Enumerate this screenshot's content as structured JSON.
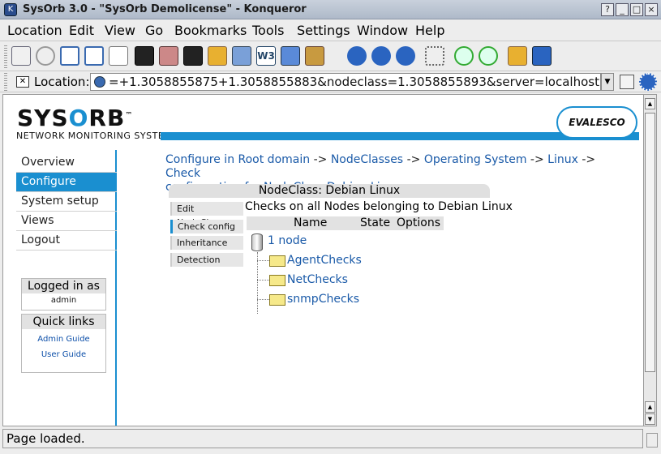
{
  "window": {
    "title": "SysOrb 3.0 - \"SysOrb Demolicense\" - Konqueror"
  },
  "menu": [
    "Location",
    "Edit",
    "View",
    "Go",
    "Bookmarks",
    "Tools",
    "Settings",
    "Window",
    "Help"
  ],
  "location": {
    "label": "Location:",
    "url": "=+1.3058855875+1.3058855883&nodeclass=1.3058855893&server=localhost:2211"
  },
  "site": {
    "logo_pre": "SYS",
    "logo_o": "O",
    "logo_post": "RB",
    "tm": "™",
    "tagline": "NETWORK MONITORING SYSTEM",
    "partner_logo": "EVALESCO"
  },
  "nav": [
    "Overview",
    "Configure",
    "System setup",
    "Views",
    "Logout"
  ],
  "logged_in": {
    "title": "Logged in as",
    "user": "admin"
  },
  "quick_links": {
    "title": "Quick links",
    "items": [
      "Admin Guide",
      "User Guide"
    ]
  },
  "breadcrumb": {
    "items": [
      "Configure in Root domain",
      "NodeClasses",
      "Operating System",
      "Linux",
      "Check"
    ],
    "line2": "configuration for NodeClass Debian Linux",
    "sep": "->"
  },
  "nodeclass": {
    "title": "NodeClass: Debian Linux"
  },
  "tabs": [
    "Edit NodeClass",
    "Check config",
    "Inheritance",
    "Detection"
  ],
  "checks": {
    "description": "Checks on all Nodes belonging to Debian Linux",
    "columns": [
      "Name",
      "State",
      "Options"
    ],
    "root": "1 node",
    "folders": [
      "AgentChecks",
      "NetChecks",
      "snmpChecks"
    ]
  },
  "status": {
    "text": "Page loaded."
  }
}
